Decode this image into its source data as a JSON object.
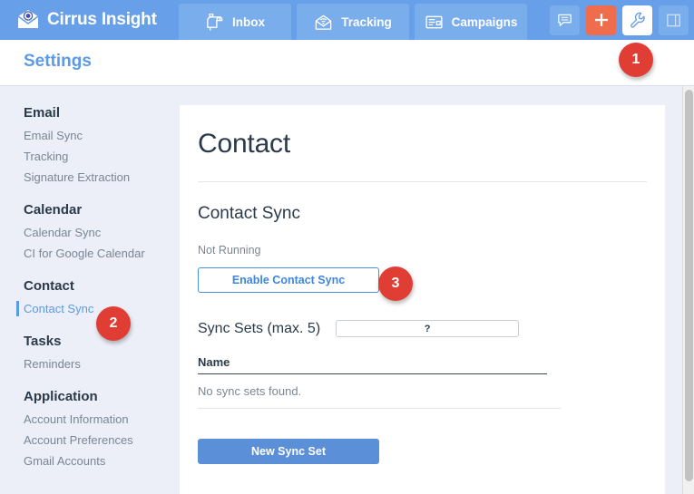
{
  "header": {
    "brand": "Cirrus Insight",
    "brand_logo_icon": "envelope-eye-logo-icon",
    "background_color": "#67a0e8",
    "tabs": [
      {
        "label": "Inbox",
        "icon": "mailbox-icon"
      },
      {
        "label": "Tracking",
        "icon": "envelope-signal-icon"
      },
      {
        "label": "Campaigns",
        "icon": "campaign-card-icon"
      }
    ],
    "actions": [
      {
        "name": "chat-button",
        "icon": "chat-bubble-icon",
        "color": "#7aadec"
      },
      {
        "name": "add-button",
        "icon": "plus-icon",
        "color": "#ef6c4d"
      },
      {
        "name": "settings-button",
        "icon": "wrench-icon",
        "color": "#ffffff",
        "active": true
      },
      {
        "name": "panel-toggle-button",
        "icon": "split-panel-icon",
        "color": "#7aadec"
      }
    ]
  },
  "subheader": {
    "title": "Settings",
    "title_color": "#5b9ae6"
  },
  "sidebar": {
    "groups": [
      {
        "title": "Email",
        "items": [
          {
            "label": "Email Sync",
            "active": false
          },
          {
            "label": "Tracking",
            "active": false
          },
          {
            "label": "Signature Extraction",
            "active": false
          }
        ]
      },
      {
        "title": "Calendar",
        "items": [
          {
            "label": "Calendar Sync",
            "active": false
          },
          {
            "label": "CI for Google Calendar",
            "active": false
          }
        ]
      },
      {
        "title": "Contact",
        "items": [
          {
            "label": "Contact Sync",
            "active": true
          }
        ]
      },
      {
        "title": "Tasks",
        "items": [
          {
            "label": "Reminders",
            "active": false
          }
        ]
      },
      {
        "title": "Application",
        "items": [
          {
            "label": "Account Information",
            "active": false
          },
          {
            "label": "Account Preferences",
            "active": false
          },
          {
            "label": "Gmail Accounts",
            "active": false
          }
        ]
      }
    ]
  },
  "main": {
    "page_title": "Contact",
    "section_title": "Contact Sync",
    "status": "Not Running",
    "enable_button": "Enable Contact Sync",
    "sync_sets_label": "Sync Sets (max. 5)",
    "sync_sets_field_value": "?",
    "table": {
      "columns": [
        "Name"
      ],
      "empty_message": "No sync sets found."
    },
    "new_sync_set_button": "New Sync Set"
  },
  "annotations": {
    "badge_color": "#e03e34",
    "steps": [
      {
        "number": "1",
        "target": "settings-wrench-button"
      },
      {
        "number": "2",
        "target": "sidebar-item-contact-sync"
      },
      {
        "number": "3",
        "target": "enable-contact-sync-button"
      }
    ]
  }
}
